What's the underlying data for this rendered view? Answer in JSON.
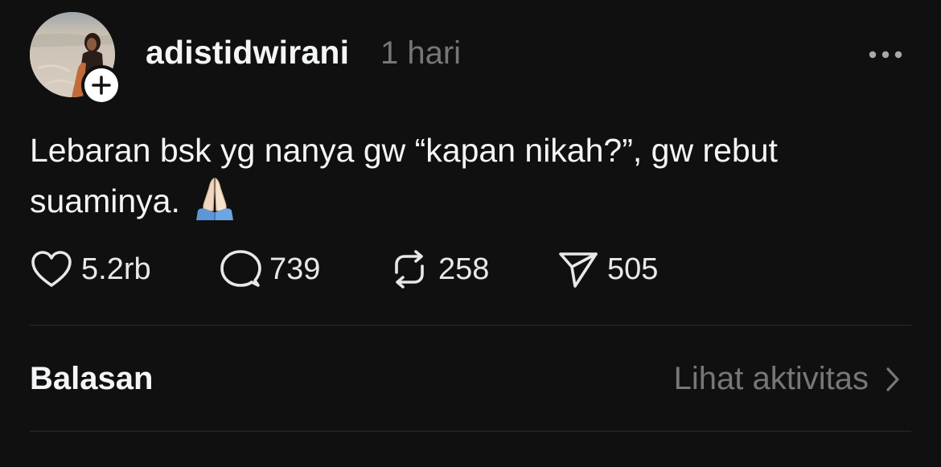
{
  "post": {
    "username": "adistidwirani",
    "timestamp": "1 hari",
    "text_line1": "Lebaran bsk yg nanya gw “kapan nikah?”, gw rebut",
    "text_line2": "suaminya.",
    "emoji": "folded-hands"
  },
  "actions": {
    "likes": "5.2rb",
    "comments": "739",
    "reposts": "258",
    "shares": "505"
  },
  "footer": {
    "replies_label": "Balasan",
    "activity_link": "Lihat aktivitas"
  },
  "icons": {
    "more": "more-horizontal-icon",
    "follow": "plus-icon",
    "like": "heart-icon",
    "comment": "comment-icon",
    "repost": "repost-icon",
    "share": "send-icon",
    "chevron": "chevron-right-icon"
  },
  "colors": {
    "background": "#101010",
    "text": "#f3f5f7",
    "muted": "#777777",
    "divider": "#2c2c2c"
  }
}
